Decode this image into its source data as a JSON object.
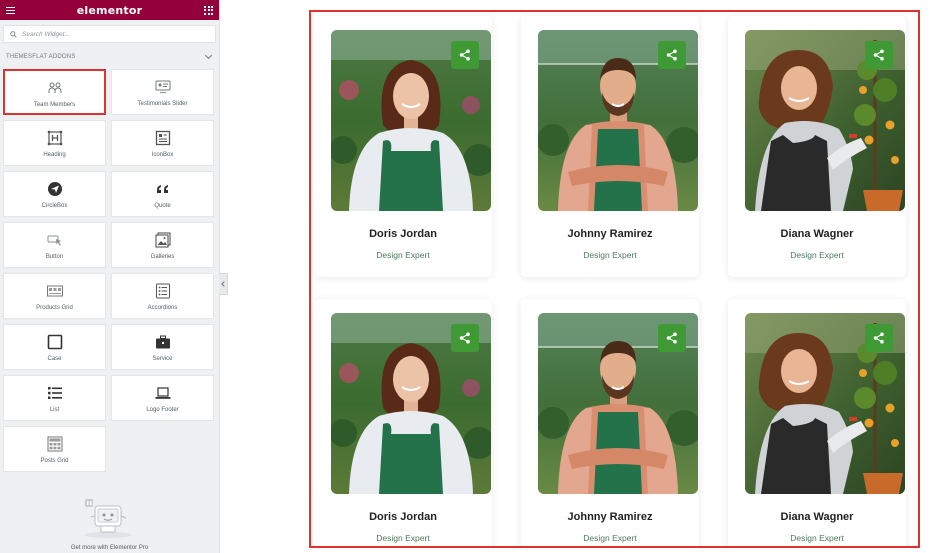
{
  "editor": {
    "brand": "elementor",
    "search_placeholder": "Search Widget...",
    "section_title": "THEMESFLAT ADDONS",
    "widgets": [
      {
        "label": "Team Members",
        "icon": "team-members-icon",
        "active": true
      },
      {
        "label": "Testimonials Slider",
        "icon": "testimonials-slider-icon"
      },
      {
        "label": "Heading",
        "icon": "heading-icon"
      },
      {
        "label": "IconBox",
        "icon": "iconbox-icon"
      },
      {
        "label": "CircleBox",
        "icon": "circlebox-icon"
      },
      {
        "label": "Quote",
        "icon": "quote-icon"
      },
      {
        "label": "Button",
        "icon": "button-icon"
      },
      {
        "label": "Galleries",
        "icon": "galleries-icon"
      },
      {
        "label": "Products Grid",
        "icon": "products-grid-icon"
      },
      {
        "label": "Accordions",
        "icon": "accordions-icon"
      },
      {
        "label": "Case",
        "icon": "case-icon"
      },
      {
        "label": "Service",
        "icon": "service-icon"
      },
      {
        "label": "List",
        "icon": "list-icon"
      },
      {
        "label": "Logo Footer",
        "icon": "logo-footer-icon"
      },
      {
        "label": "Posts Grid",
        "icon": "posts-grid-icon"
      }
    ],
    "promo_text": "Get more with Elementor Pro"
  },
  "team": {
    "members": [
      {
        "name": "Doris Jordan",
        "role": "Design Expert"
      },
      {
        "name": "Johnny Ramirez",
        "role": "Design Expert"
      },
      {
        "name": "Diana Wagner",
        "role": "Design Expert"
      },
      {
        "name": "Doris Jordan",
        "role": "Design Expert"
      },
      {
        "name": "Johnny Ramirez",
        "role": "Design Expert"
      },
      {
        "name": "Diana Wagner",
        "role": "Design Expert"
      }
    ]
  },
  "colors": {
    "brand_bar": "#93003a",
    "share_button": "#3f9a36",
    "highlight": "#e03131",
    "role_text": "#4e7a5a"
  }
}
